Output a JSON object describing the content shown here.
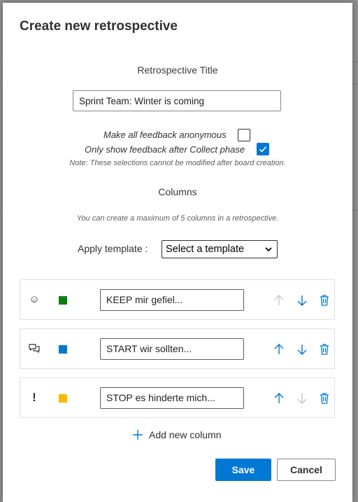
{
  "dialog": {
    "title": "Create new retrospective",
    "retro_title_label": "Retrospective Title",
    "retro_title_value": "Sprint Team: Winter is coming",
    "options": [
      {
        "label": "Make all feedback anonymous",
        "checked": false
      },
      {
        "label": "Only show feedback after Collect phase",
        "checked": true
      }
    ],
    "note": "Note: These selections cannot be modified after board creation.",
    "columns_label": "Columns",
    "columns_hint": "You can create a maximum of 5 columns in a retrospective.",
    "template_label": "Apply template :",
    "template_value": "Select a template",
    "columns": [
      {
        "icon": "smiley-icon",
        "icon_glyph": "☺",
        "color": "#107c10",
        "value": "KEEP mir gefiel...",
        "up_enabled": false,
        "down_enabled": true
      },
      {
        "icon": "chat-icon",
        "icon_glyph": "🗪",
        "color": "#0078d4",
        "value": "START wir sollten...",
        "up_enabled": true,
        "down_enabled": true
      },
      {
        "icon": "exclamation-icon",
        "icon_glyph": "!",
        "color": "#ffb900",
        "value": "STOP es hinderte mich...",
        "up_enabled": true,
        "down_enabled": false
      }
    ],
    "add_column_label": "Add new column",
    "save_label": "Save",
    "cancel_label": "Cancel",
    "accent_color": "#0078d4"
  }
}
